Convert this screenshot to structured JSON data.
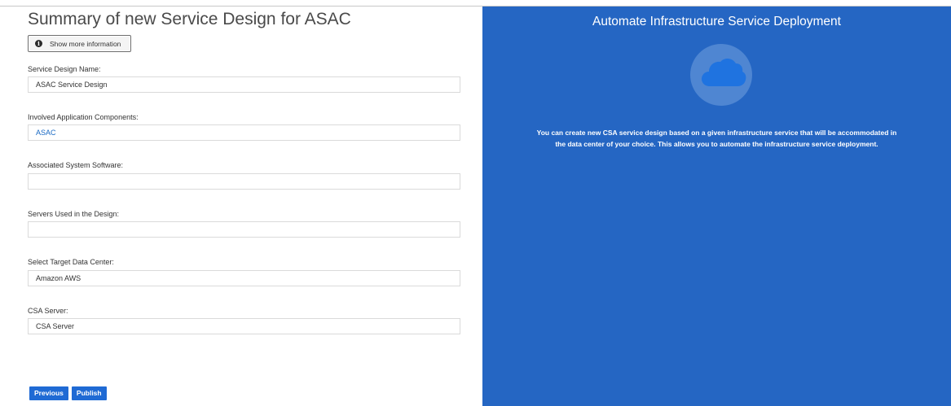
{
  "left": {
    "title": "Summary of new Service Design for ASAC",
    "info_button_label": "Show more information",
    "fields": [
      {
        "label": "Service Design Name:",
        "value": "ASAC Service Design"
      },
      {
        "label": "Involved Application Components:",
        "value": "ASAC"
      },
      {
        "label": "Associated System Software:",
        "value": ""
      },
      {
        "label": "Servers Used in the Design:",
        "value": ""
      },
      {
        "label": "Select Target Data Center:",
        "value": "Amazon AWS"
      },
      {
        "label": "CSA Server:",
        "value": "CSA Server"
      }
    ],
    "buttons": {
      "previous": "Previous",
      "publish": "Publish"
    }
  },
  "right": {
    "title": "Automate Infrastructure Service Deployment",
    "description_line1": "You can create new CSA service design based on a given infrastructure service that will be accommodated in",
    "description_line2": "the data center of your choice. This allows you to automate the infrastructure service deployment.",
    "icon": "cloud-icon"
  },
  "colors": {
    "panel_blue": "#2566c3",
    "button_blue": "#1f6ad4",
    "link_blue": "#1a6ac4",
    "icon_circle": "#4f86d2",
    "cloud_blue": "#1f73e0"
  }
}
